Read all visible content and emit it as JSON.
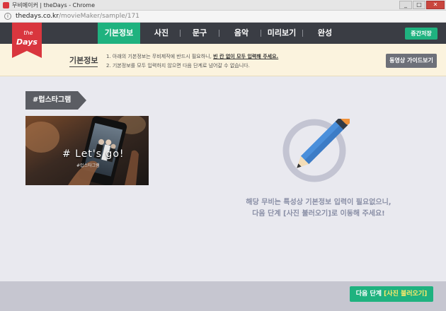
{
  "window": {
    "title": "무비메이커 | theDays - Chrome",
    "buttons": [
      "_",
      "□",
      "✕"
    ]
  },
  "address": {
    "host": "thedays.co.kr",
    "path": "/movieMaker/sample/171"
  },
  "logo": {
    "top": "the",
    "bottom": "Days"
  },
  "nav": {
    "items": [
      "기본정보",
      "사진",
      "문구",
      "음악",
      "미리보기",
      "완성"
    ],
    "active_index": 0
  },
  "header": {
    "save_label": "중간저장"
  },
  "info": {
    "title": "기본정보",
    "line1_prefix": "1. 아래의 기본정보는 무비제작에 반드시 필요하니,",
    "line1_emphasis": "빈 칸 없이 모두 입력해 주세요.",
    "line2": "2. 기본정보를 모두 입력하지 않으면 다음 단계로 넘어갈 수 없습니다.",
    "guide_label": "동영상 가이드보기"
  },
  "sample": {
    "tag": "#럽스타그램",
    "caption": "# Let's go!",
    "caption_sub": "#럽스타그램"
  },
  "message": {
    "line1": "해당 무비는 특성상 기본정보 입력이 필요없으니,",
    "line2": "다음 단계 [사진 불러오기]로 이동해 주세요!"
  },
  "footer": {
    "next_prefix": "다음 단계",
    "next_highlight": "[사진 불러오기]"
  },
  "colors": {
    "accent": "#1fb27f",
    "header_bg": "#3a3d44",
    "logo_red": "#d9363e",
    "info_bg": "#fbf3de",
    "main_bg": "#e9e9ef",
    "footer_bg": "#c6c6d0"
  }
}
